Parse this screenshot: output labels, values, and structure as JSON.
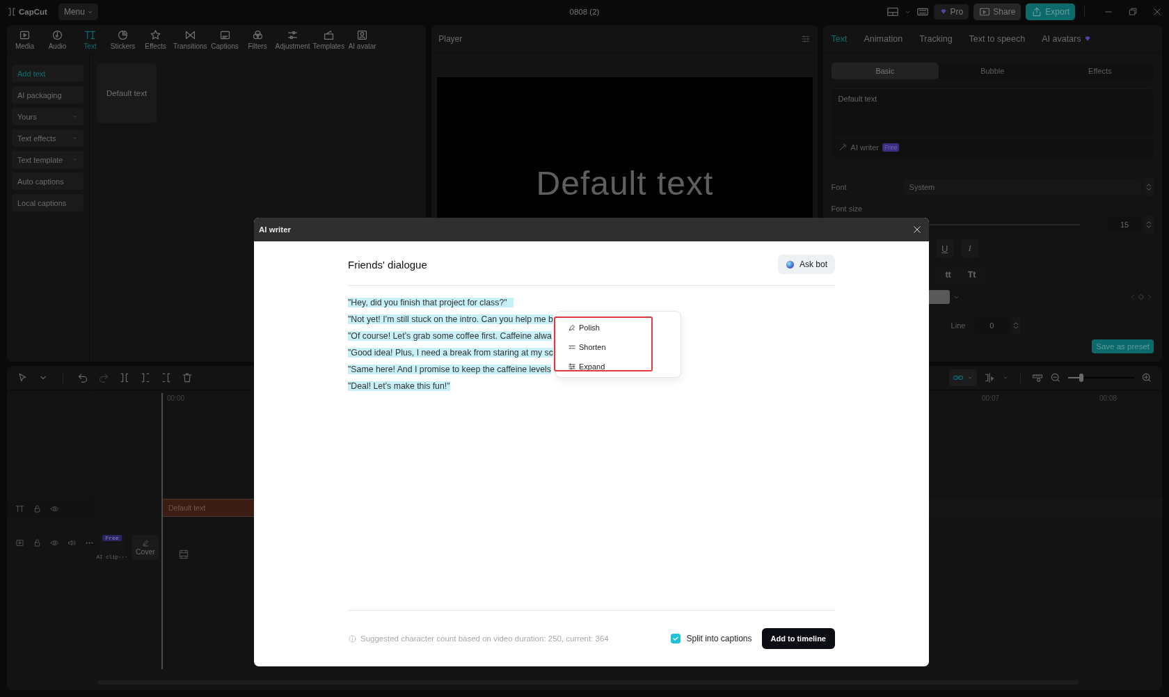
{
  "app": {
    "logo": "CapCut",
    "menu": "Menu",
    "project_title": "0808 (2)",
    "pro": "Pro",
    "share": "Share",
    "export": "Export"
  },
  "toolbar": [
    {
      "label": "Media",
      "kind": "media",
      "selected": false
    },
    {
      "label": "Audio",
      "kind": "audio",
      "selected": false
    },
    {
      "label": "Text",
      "kind": "text",
      "selected": true
    },
    {
      "label": "Stickers",
      "kind": "stickers",
      "selected": false
    },
    {
      "label": "Effects",
      "kind": "effects",
      "selected": false
    },
    {
      "label": "Transitions",
      "kind": "transitions",
      "selected": false
    },
    {
      "label": "Captions",
      "kind": "captions",
      "selected": false
    },
    {
      "label": "Filters",
      "kind": "filters",
      "selected": false
    },
    {
      "label": "Adjustment",
      "kind": "adjustment",
      "selected": false
    },
    {
      "label": "Templates",
      "kind": "templates",
      "selected": false
    },
    {
      "label": "AI avatar",
      "kind": "avatar",
      "selected": false
    }
  ],
  "sidebar": [
    {
      "label": "Add text",
      "selected": true,
      "expandable": false
    },
    {
      "label": "AI packaging",
      "selected": false,
      "expandable": false
    },
    {
      "label": "Yours",
      "selected": false,
      "expandable": true
    },
    {
      "label": "Text effects",
      "selected": false,
      "expandable": true
    },
    {
      "label": "Text template",
      "selected": false,
      "expandable": true
    },
    {
      "label": "Auto captions",
      "selected": false,
      "expandable": false
    },
    {
      "label": "Local captions",
      "selected": false,
      "expandable": false
    }
  ],
  "text_card": "Default text",
  "player": {
    "title": "Player",
    "preview_text": "Default text"
  },
  "inspector": {
    "tabs": [
      {
        "label": "Text",
        "selected": true,
        "premium": false
      },
      {
        "label": "Animation",
        "selected": false,
        "premium": false
      },
      {
        "label": "Tracking",
        "selected": false,
        "premium": false
      },
      {
        "label": "Text to speech",
        "selected": false,
        "premium": false
      },
      {
        "label": "AI avatars",
        "selected": false,
        "premium": true
      }
    ],
    "subtabs": [
      {
        "label": "Basic",
        "selected": true
      },
      {
        "label": "Bubble",
        "selected": false
      },
      {
        "label": "Effects",
        "selected": false
      }
    ],
    "text_value": "Default text",
    "ai_writer": "AI writer",
    "ai_badge": "Free",
    "font_label": "Font",
    "font_value": "System",
    "font_size_label": "Font size",
    "font_size_value": "15",
    "style_buttons": [
      "U",
      "I"
    ],
    "case_buttons": [
      "tt",
      "Tt"
    ],
    "line_label": "Line",
    "line_value": "0",
    "save_preset": "Save as preset"
  },
  "timeline": {
    "ruler": [
      "00:00",
      "00:07",
      "00:08"
    ],
    "text_clip": "Default text",
    "ai_clip_badge": "Free",
    "ai_clip": "AI clip···",
    "cover": "Cover",
    "link_on": true,
    "zoom": {
      "level": 0.2
    }
  },
  "modal": {
    "title": "AI writer",
    "heading": "Friends' dialogue",
    "ask_bot": "Ask bot",
    "lines": [
      "\"Hey, did you finish that project for class?\"",
      "\"Not yet! I’m still stuck on the intro. Can you help me b",
      "\"Of course! Let’s grab some coffee first. Caffeine alwa",
      "\"Good idea! Plus, I need a break from staring at my sc",
      "\"Same here! And I promise to keep the caffeine levels",
      "\"Deal! Let’s make this fun!\""
    ],
    "menu": [
      {
        "label": "Polish",
        "kind": "polish"
      },
      {
        "label": "Shorten",
        "kind": "shorten"
      },
      {
        "label": "Expand",
        "kind": "expand"
      }
    ],
    "hint": "Suggested character count based on video duration: 250, current: 364",
    "split_captions": {
      "label": "Split into captions",
      "checked": true
    },
    "add_button": "Add to timeline"
  }
}
